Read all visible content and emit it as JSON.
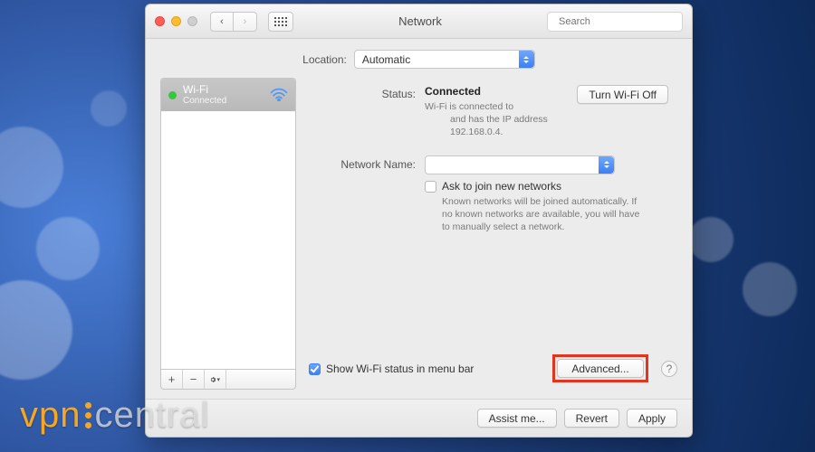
{
  "window": {
    "title": "Network"
  },
  "search": {
    "placeholder": "Search"
  },
  "location": {
    "label": "Location:",
    "value": "Automatic"
  },
  "sidebar": {
    "services": [
      {
        "name": "Wi-Fi",
        "status": "Connected"
      }
    ],
    "icon": "wifi-icon",
    "status_color": "#37c63f"
  },
  "detail": {
    "status_label": "Status:",
    "status_value": "Connected",
    "toggle_btn": "Turn Wi-Fi Off",
    "status_desc_1": "Wi-Fi is connected to",
    "status_desc_2": "and has the IP address 192.168.0.4.",
    "netname_label": "Network Name:",
    "netname_value": "",
    "ask_join": "Ask to join new networks",
    "ask_join_desc": "Known networks will be joined automatically. If no known networks are available, you will have to manually select a network.",
    "show_status": "Show Wi-Fi status in menu bar",
    "advanced_btn": "Advanced...",
    "help": "?"
  },
  "footer": {
    "assist": "Assist me...",
    "revert": "Revert",
    "apply": "Apply"
  },
  "watermark": {
    "left": "vpn",
    "right": "central"
  },
  "colors": {
    "accent": "#3e7ff3",
    "highlight": "#e2341f"
  }
}
